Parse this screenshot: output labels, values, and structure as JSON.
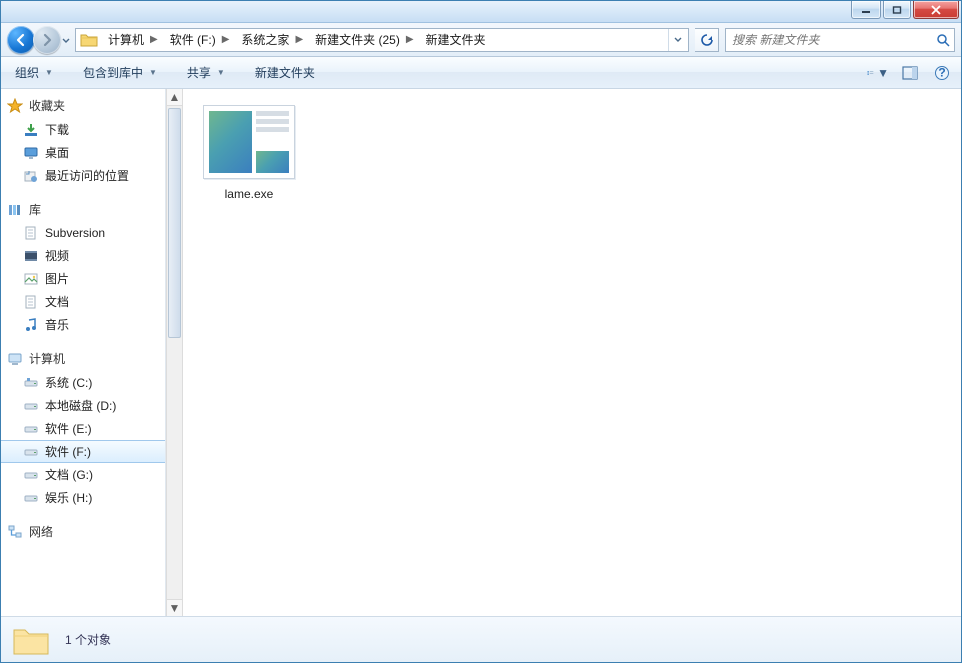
{
  "titlebar": {
    "title": ""
  },
  "breadcrumbs": [
    {
      "label": "计算机"
    },
    {
      "label": "软件 (F:)"
    },
    {
      "label": "系统之家"
    },
    {
      "label": "新建文件夹 (25)"
    },
    {
      "label": "新建文件夹"
    }
  ],
  "search": {
    "placeholder": "搜索 新建文件夹"
  },
  "toolbar": {
    "organize": "组织",
    "include": "包含到库中",
    "share": "共享",
    "new_folder": "新建文件夹"
  },
  "sidebar": {
    "favorites": {
      "heading": "收藏夹",
      "items": [
        {
          "label": "下载"
        },
        {
          "label": "桌面"
        },
        {
          "label": "最近访问的位置"
        }
      ]
    },
    "libraries": {
      "heading": "库",
      "items": [
        {
          "label": "Subversion"
        },
        {
          "label": "视频"
        },
        {
          "label": "图片"
        },
        {
          "label": "文档"
        },
        {
          "label": "音乐"
        }
      ]
    },
    "computer": {
      "heading": "计算机",
      "items": [
        {
          "label": "系统 (C:)"
        },
        {
          "label": "本地磁盘 (D:)"
        },
        {
          "label": "软件 (E:)"
        },
        {
          "label": "软件 (F:)",
          "selected": true
        },
        {
          "label": "文档 (G:)"
        },
        {
          "label": "娱乐 (H:)"
        }
      ]
    },
    "network": {
      "heading": "网络"
    }
  },
  "files": [
    {
      "name": "lame.exe"
    }
  ],
  "status": {
    "count_text": "1 个对象"
  }
}
